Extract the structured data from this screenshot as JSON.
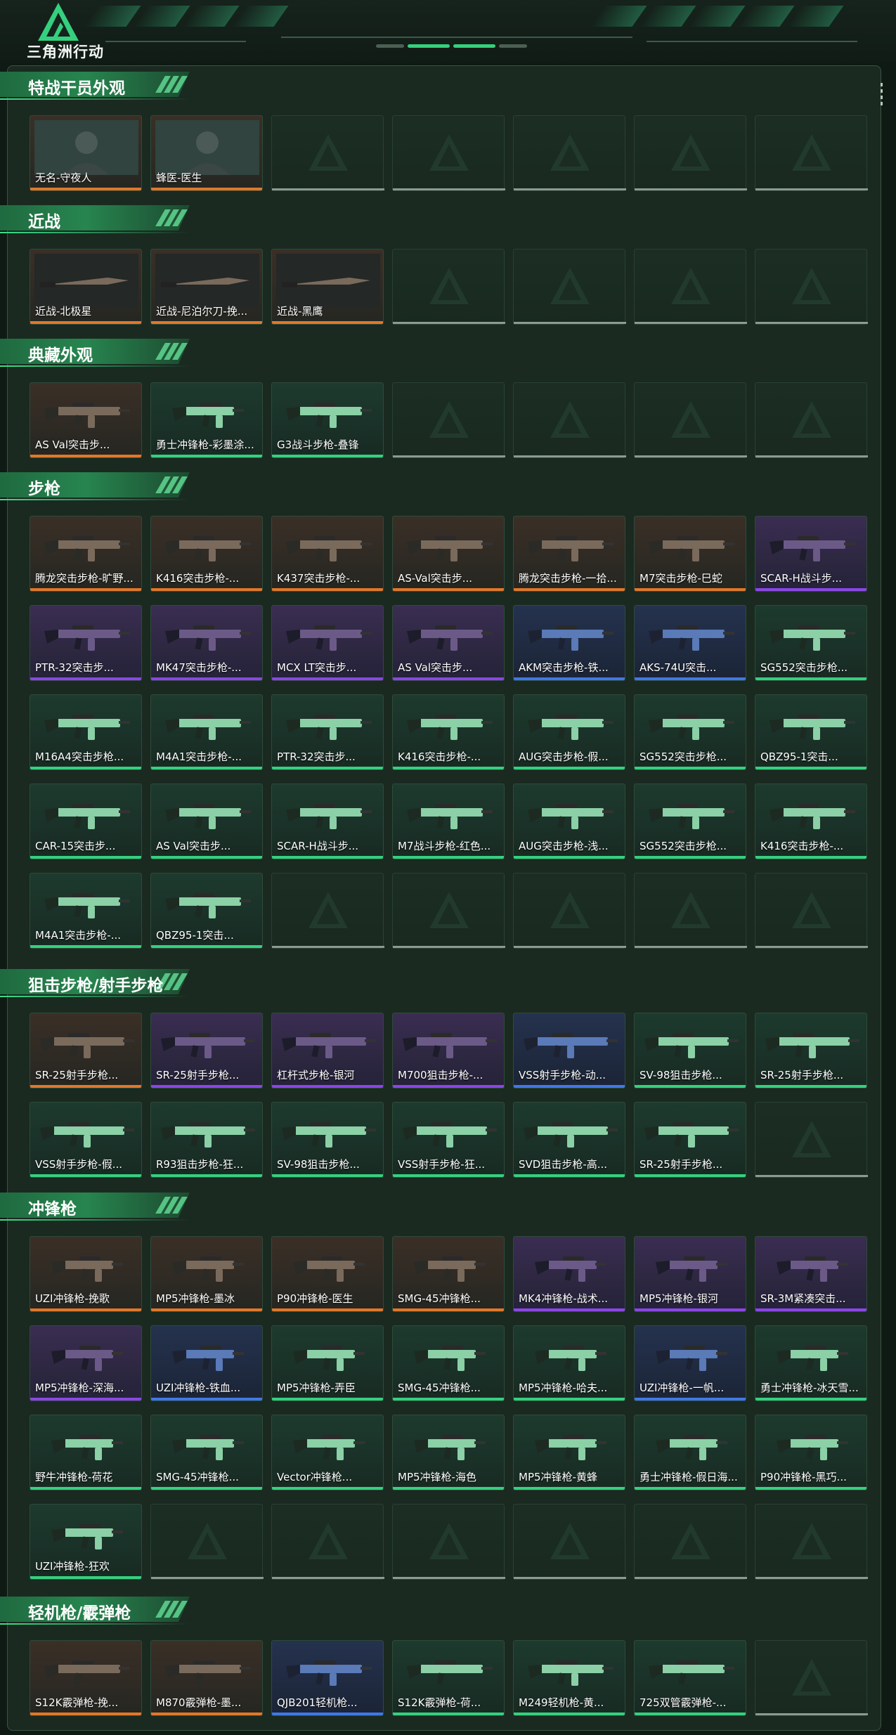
{
  "app": {
    "title": "三角洲行动"
  },
  "colors": {
    "orange": "#e0782a",
    "purple": "#8b46e6",
    "blue": "#3f78e8",
    "green": "#35d07f",
    "accent": "#3de08a"
  },
  "sections": [
    {
      "title": "特战干员外观",
      "slots": 7,
      "items": [
        {
          "name": "无名-守夜人",
          "rarity": "orange",
          "icon": "operator-portrait"
        },
        {
          "name": "蜂医-医生",
          "rarity": "orange",
          "icon": "operator-portrait"
        }
      ]
    },
    {
      "title": "近战",
      "slots": 7,
      "items": [
        {
          "name": "近战-北极星",
          "rarity": "orange",
          "icon": "knife"
        },
        {
          "name": "近战-尼泊尔刀-挽...",
          "rarity": "orange",
          "icon": "knife"
        },
        {
          "name": "近战-黑鹰",
          "rarity": "orange",
          "icon": "knife"
        }
      ]
    },
    {
      "title": "典藏外观",
      "slots": 7,
      "items": [
        {
          "name": "AS Val突击步...",
          "rarity": "orange",
          "icon": "rifle"
        },
        {
          "name": "勇士冲锋枪-彩墨涂...",
          "rarity": "green",
          "icon": "smg"
        },
        {
          "name": "G3战斗步枪-叠锋",
          "rarity": "green",
          "icon": "rifle"
        }
      ]
    },
    {
      "title": "步枪",
      "slots": 35,
      "items": [
        {
          "name": "腾龙突击步枪-旷野...",
          "rarity": "orange",
          "icon": "rifle"
        },
        {
          "name": "K416突击步枪-...",
          "rarity": "orange",
          "icon": "rifle"
        },
        {
          "name": "K437突击步枪-...",
          "rarity": "orange",
          "icon": "rifle"
        },
        {
          "name": "AS-Val突击步...",
          "rarity": "orange",
          "icon": "rifle"
        },
        {
          "name": "腾龙突击步枪-一拾...",
          "rarity": "orange",
          "icon": "rifle"
        },
        {
          "name": "M7突击步枪-巳蛇",
          "rarity": "orange",
          "icon": "rifle"
        },
        {
          "name": "SCAR-H战斗步...",
          "rarity": "purple",
          "icon": "rifle"
        },
        {
          "name": "PTR-32突击步...",
          "rarity": "purple",
          "icon": "rifle"
        },
        {
          "name": "MK47突击步枪-...",
          "rarity": "purple",
          "icon": "rifle"
        },
        {
          "name": "MCX LT突击步...",
          "rarity": "purple",
          "icon": "rifle"
        },
        {
          "name": "AS Val突击步...",
          "rarity": "purple",
          "icon": "rifle"
        },
        {
          "name": "AKM突击步枪-铁...",
          "rarity": "blue",
          "icon": "rifle"
        },
        {
          "name": "AKS-74U突击...",
          "rarity": "blue",
          "icon": "rifle"
        },
        {
          "name": "SG552突击步枪...",
          "rarity": "green",
          "icon": "rifle"
        },
        {
          "name": "M16A4突击步枪...",
          "rarity": "green",
          "icon": "rifle"
        },
        {
          "name": "M4A1突击步枪-...",
          "rarity": "green",
          "icon": "rifle"
        },
        {
          "name": "PTR-32突击步...",
          "rarity": "green",
          "icon": "rifle"
        },
        {
          "name": "K416突击步枪-...",
          "rarity": "green",
          "icon": "rifle"
        },
        {
          "name": "AUG突击步枪-假...",
          "rarity": "green",
          "icon": "rifle"
        },
        {
          "name": "SG552突击步枪...",
          "rarity": "green",
          "icon": "rifle"
        },
        {
          "name": "QBZ95-1突击...",
          "rarity": "green",
          "icon": "rifle"
        },
        {
          "name": "CAR-15突击步...",
          "rarity": "green",
          "icon": "rifle"
        },
        {
          "name": "AS Val突击步...",
          "rarity": "green",
          "icon": "rifle"
        },
        {
          "name": "SCAR-H战斗步...",
          "rarity": "green",
          "icon": "rifle"
        },
        {
          "name": "M7战斗步枪-红色...",
          "rarity": "green",
          "icon": "rifle"
        },
        {
          "name": "AUG突击步枪-浅...",
          "rarity": "green",
          "icon": "rifle"
        },
        {
          "name": "SG552突击步枪...",
          "rarity": "green",
          "icon": "rifle"
        },
        {
          "name": "K416突击步枪-...",
          "rarity": "green",
          "icon": "rifle"
        },
        {
          "name": "M4A1突击步枪-...",
          "rarity": "green",
          "icon": "rifle"
        },
        {
          "name": "QBZ95-1突击...",
          "rarity": "green",
          "icon": "rifle"
        }
      ]
    },
    {
      "title": "狙击步枪/射手步枪",
      "slots": 14,
      "items": [
        {
          "name": "SR-25射手步枪...",
          "rarity": "orange",
          "icon": "sniper"
        },
        {
          "name": "SR-25射手步枪...",
          "rarity": "purple",
          "icon": "sniper"
        },
        {
          "name": "杠杆式步枪-银河",
          "rarity": "purple",
          "icon": "sniper"
        },
        {
          "name": "M700狙击步枪-...",
          "rarity": "purple",
          "icon": "sniper"
        },
        {
          "name": "VSS射手步枪-动...",
          "rarity": "blue",
          "icon": "sniper"
        },
        {
          "name": "SV-98狙击步枪...",
          "rarity": "green",
          "icon": "sniper"
        },
        {
          "name": "SR-25射手步枪...",
          "rarity": "green",
          "icon": "sniper"
        },
        {
          "name": "VSS射手步枪-假...",
          "rarity": "green",
          "icon": "sniper"
        },
        {
          "name": "R93狙击步枪-狂...",
          "rarity": "green",
          "icon": "sniper"
        },
        {
          "name": "SV-98狙击步枪...",
          "rarity": "green",
          "icon": "sniper"
        },
        {
          "name": "VSS射手步枪-狂...",
          "rarity": "green",
          "icon": "sniper"
        },
        {
          "name": "SVD狙击步枪-高...",
          "rarity": "green",
          "icon": "sniper"
        },
        {
          "name": "SR-25射手步枪...",
          "rarity": "green",
          "icon": "sniper"
        }
      ]
    },
    {
      "title": "冲锋枪",
      "slots": 28,
      "items": [
        {
          "name": "UZI冲锋枪-挽歌",
          "rarity": "orange",
          "icon": "smg"
        },
        {
          "name": "MP5冲锋枪-墨冰",
          "rarity": "orange",
          "icon": "smg"
        },
        {
          "name": "P90冲锋枪-医生",
          "rarity": "orange",
          "icon": "smg"
        },
        {
          "name": "SMG-45冲锋枪...",
          "rarity": "orange",
          "icon": "smg"
        },
        {
          "name": "MK4冲锋枪-战术...",
          "rarity": "purple",
          "icon": "smg"
        },
        {
          "name": "MP5冲锋枪-银河",
          "rarity": "purple",
          "icon": "smg"
        },
        {
          "name": "SR-3M紧凑突击...",
          "rarity": "purple",
          "icon": "smg"
        },
        {
          "name": "MP5冲锋枪-深海...",
          "rarity": "purple",
          "icon": "smg"
        },
        {
          "name": "UZI冲锋枪-铁血...",
          "rarity": "blue",
          "icon": "smg"
        },
        {
          "name": "MP5冲锋枪-弄臣",
          "rarity": "green",
          "icon": "smg"
        },
        {
          "name": "SMG-45冲锋枪...",
          "rarity": "green",
          "icon": "smg"
        },
        {
          "name": "MP5冲锋枪-哈夫...",
          "rarity": "green",
          "icon": "smg"
        },
        {
          "name": "UZI冲锋枪-一帆...",
          "rarity": "blue",
          "icon": "smg"
        },
        {
          "name": "勇士冲锋枪-冰天雪...",
          "rarity": "green",
          "icon": "smg"
        },
        {
          "name": "野牛冲锋枪-荷花",
          "rarity": "green",
          "icon": "smg"
        },
        {
          "name": "SMG-45冲锋枪...",
          "rarity": "green",
          "icon": "smg"
        },
        {
          "name": "Vector冲锋枪...",
          "rarity": "green",
          "icon": "smg"
        },
        {
          "name": "MP5冲锋枪-海色",
          "rarity": "green",
          "icon": "smg"
        },
        {
          "name": "MP5冲锋枪-黄蜂",
          "rarity": "green",
          "icon": "smg"
        },
        {
          "name": "勇士冲锋枪-假日海...",
          "rarity": "green",
          "icon": "smg"
        },
        {
          "name": "P90冲锋枪-黑巧...",
          "rarity": "green",
          "icon": "smg"
        },
        {
          "name": "UZI冲锋枪-狂欢",
          "rarity": "green",
          "icon": "smg"
        }
      ]
    },
    {
      "title": "轻机枪/霰弹枪",
      "slots": 7,
      "items": [
        {
          "name": "S12K霰弹枪-挽...",
          "rarity": "orange",
          "icon": "shotgun"
        },
        {
          "name": "M870霰弹枪-墨...",
          "rarity": "orange",
          "icon": "shotgun"
        },
        {
          "name": "QJB201轻机枪...",
          "rarity": "blue",
          "icon": "lmg"
        },
        {
          "name": "S12K霰弹枪-荷...",
          "rarity": "green",
          "icon": "shotgun"
        },
        {
          "name": "M249轻机枪-黄...",
          "rarity": "green",
          "icon": "lmg"
        },
        {
          "name": "725双管霰弹枪-...",
          "rarity": "green",
          "icon": "shotgun"
        }
      ]
    }
  ]
}
